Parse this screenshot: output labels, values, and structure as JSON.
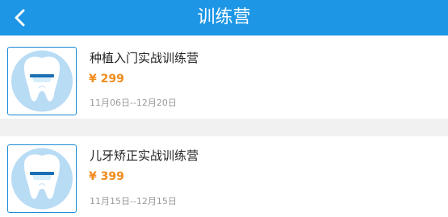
{
  "header": {
    "title": "训练营",
    "background": "#1e96e6"
  },
  "courses": [
    {
      "name": "种植入门实战训练营",
      "price": "¥ 299",
      "dates": "11月06日--12月20日",
      "icon": "tooth-icon"
    },
    {
      "name": "儿牙矫正实战训练营",
      "price": "¥ 399",
      "dates": "11月15日--12月15日",
      "icon": "tooth-icon"
    }
  ],
  "colors": {
    "accent": "#1e96e6",
    "price": "#f08c1e",
    "thumb_bg": "#b9dcf5",
    "thumb_border": "#1b8ad6"
  }
}
